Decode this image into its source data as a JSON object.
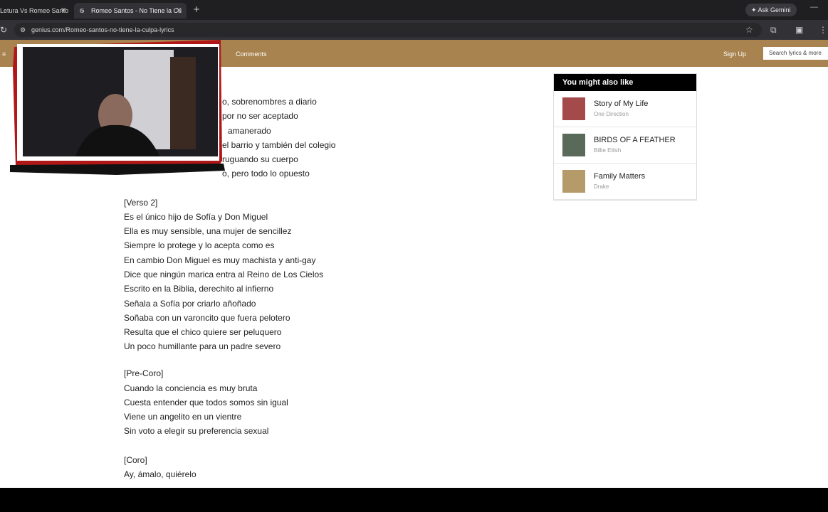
{
  "browser": {
    "tabs": [
      {
        "title": "Letura Vs Romeo Santo"
      },
      {
        "title": "Romeo Santos - No Tiene la Cu"
      }
    ],
    "new_tab": "+",
    "ask_gemini": "Ask Gemini",
    "url": "genius.com/Romeo-santos-no-tiene-la-culpa-lyrics"
  },
  "genius": {
    "menu_icon": "≡",
    "nav_comments": "Comments",
    "sign_up": "Sign Up",
    "search_placeholder": "Search lyrics & more"
  },
  "lyrics": {
    "verse1_partial": [
      "o, sobrenombres a diario",
      "por no ser aceptado",
      "amanerado",
      "el barrio y también del colegio",
      "ruguando su cuerpo",
      "o, pero todo lo opuesto"
    ],
    "verse2_header": "[Verso 2]",
    "verse2": [
      "Es el único hijo de Sofía y Don Miguel",
      "Ella es muy sensible, una mujer de sencillez",
      "Siempre lo protege y lo acepta como es",
      "En cambio Don Miguel es muy machista y anti-gay",
      "Dice que ningún marica entra al Reino de Los Cielos",
      "Escrito en la Biblia, derechito al infierno",
      "Señala a Sofía por criarlo añoñado",
      "Soñaba con un varoncito que fuera pelotero",
      "Resulta que el chico quiere ser peluquero",
      "Un poco humillante para un padre severo"
    ],
    "precoro_header": "[Pre-Coro]",
    "precoro": [
      "Cuando la conciencia es muy bruta",
      "Cuesta entender que todos somos sin igual",
      "Viene un angelito en un vientre",
      "Sin voto a elegir su preferencia sexual"
    ],
    "coro_header": "[Coro]",
    "coro": [
      "Ay, ámalo, quiérelo"
    ]
  },
  "sidebar": {
    "header": "You might also like",
    "songs": [
      {
        "title": "Story of My Life",
        "artist": "One Direction",
        "color": "#a54a4a"
      },
      {
        "title": "BIRDS OF A FEATHER",
        "artist": "Billie Eilish",
        "color": "#5a6a5a"
      },
      {
        "title": "Family Matters",
        "artist": "Drake",
        "color": "#b59a6a"
      }
    ]
  }
}
